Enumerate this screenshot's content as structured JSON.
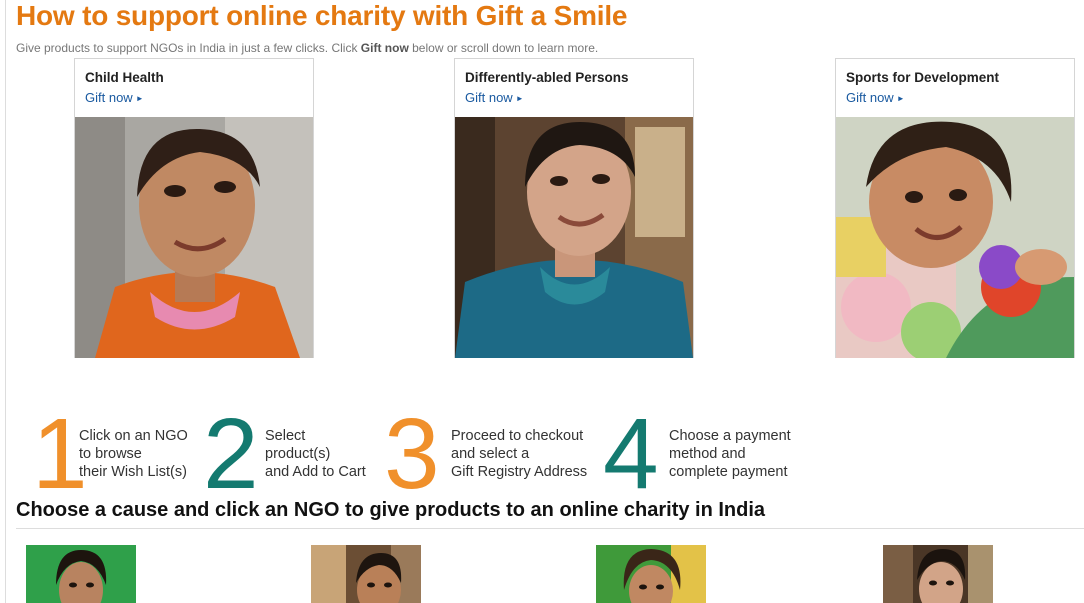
{
  "header": {
    "title": "How to support online charity with Gift a Smile",
    "subtitle_pre": "Give products to support NGOs in India in just a few clicks. Click ",
    "subtitle_bold": "Gift now",
    "subtitle_post": " below or scroll down to learn more."
  },
  "causes": [
    {
      "title": "Child Health",
      "link": "Gift now",
      "link_icon": "caret-right-icon"
    },
    {
      "title": "Differently-abled Persons",
      "link": "Gift now",
      "link_icon": "caret-right-icon"
    },
    {
      "title": "Sports for Development",
      "link": "Gift now",
      "link_icon": "caret-right-icon"
    }
  ],
  "steps": [
    {
      "number": "1",
      "text": "Click on an NGO\nto browse\ntheir Wish List(s)",
      "color": "#f0902b"
    },
    {
      "number": "2",
      "text": "Select\nproduct(s)\nand Add to Cart",
      "color": "#147a70"
    },
    {
      "number": "3",
      "text": "Proceed to checkout\nand select a\nGift Registry Address",
      "color": "#f0902b"
    },
    {
      "number": "4",
      "text": "Choose a payment\nmethod and\ncomplete payment",
      "color": "#147a70"
    }
  ],
  "section": {
    "title": "Choose a cause and click an NGO to give products to an online charity in India"
  },
  "colors": {
    "title_orange": "#e47911",
    "link_blue": "#1a5aa0",
    "step_orange": "#f0902b",
    "step_teal": "#147a70"
  }
}
